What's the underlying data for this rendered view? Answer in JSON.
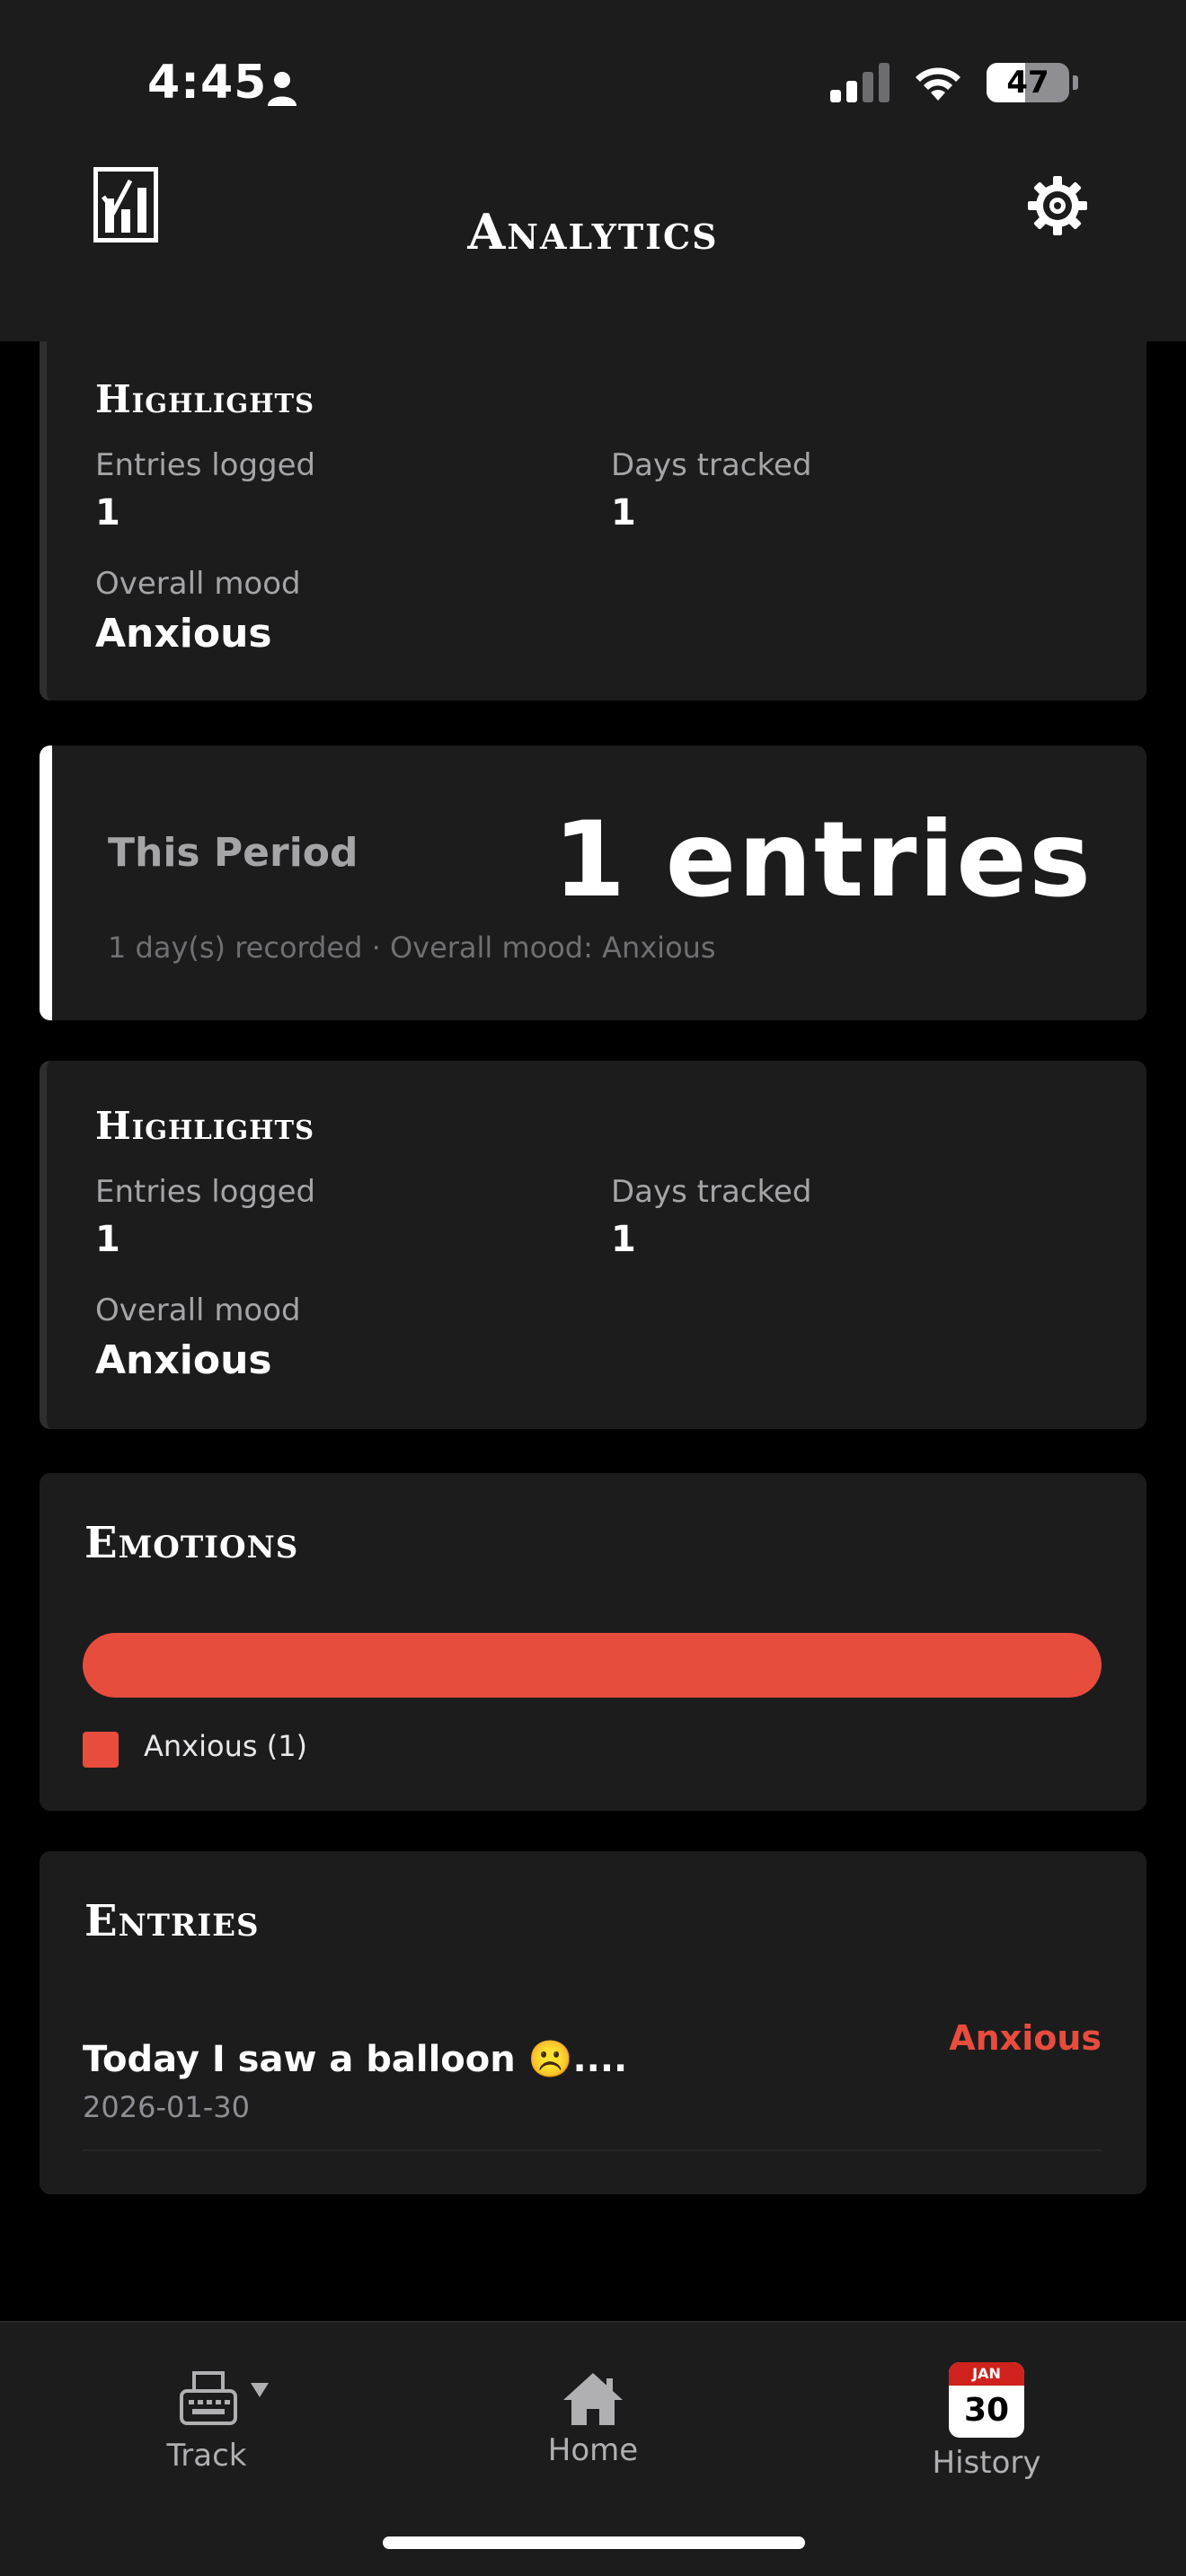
{
  "status_bar": {
    "time": "4:45",
    "battery": "47"
  },
  "header": {
    "title": "Analytics"
  },
  "highlights_top": {
    "title": "Highlights",
    "entries_logged_label": "Entries logged",
    "entries_logged_value": "1",
    "days_tracked_label": "Days tracked",
    "days_tracked_value": "1",
    "overall_mood_label": "Overall mood",
    "overall_mood_value": "Anxious"
  },
  "period": {
    "label": "This Period",
    "count": "1 entries",
    "subtitle": "1 day(s) recorded · Overall mood: Anxious"
  },
  "highlights": {
    "title": "Highlights",
    "entries_logged_label": "Entries logged",
    "entries_logged_value": "1",
    "days_tracked_label": "Days tracked",
    "days_tracked_value": "1",
    "overall_mood_label": "Overall mood",
    "overall_mood_value": "Anxious"
  },
  "emotions": {
    "title": "Emotions",
    "items": [
      {
        "name": "Anxious",
        "count": 1,
        "legend": "Anxious (1)",
        "share": 1.0,
        "color": "#e84c3d"
      }
    ]
  },
  "entries": {
    "title": "Entries",
    "items": [
      {
        "title": "Today I saw a balloon ☹️....",
        "date": "2026-01-30",
        "mood": "Anxious"
      }
    ]
  },
  "tabbar": {
    "track": "Track",
    "home": "Home",
    "history": "History",
    "calendar_month": "JAN",
    "calendar_day": "30"
  },
  "icons": [
    "person-icon",
    "signal-icon",
    "wifi-icon",
    "battery-icon",
    "logo-icon",
    "gear-icon",
    "typewriter-icon",
    "chevron-down-icon",
    "home-icon",
    "calendar-icon"
  ],
  "colors": {
    "accent": "#e84c3d",
    "card": "#1c1c1d",
    "background": "#000000"
  }
}
